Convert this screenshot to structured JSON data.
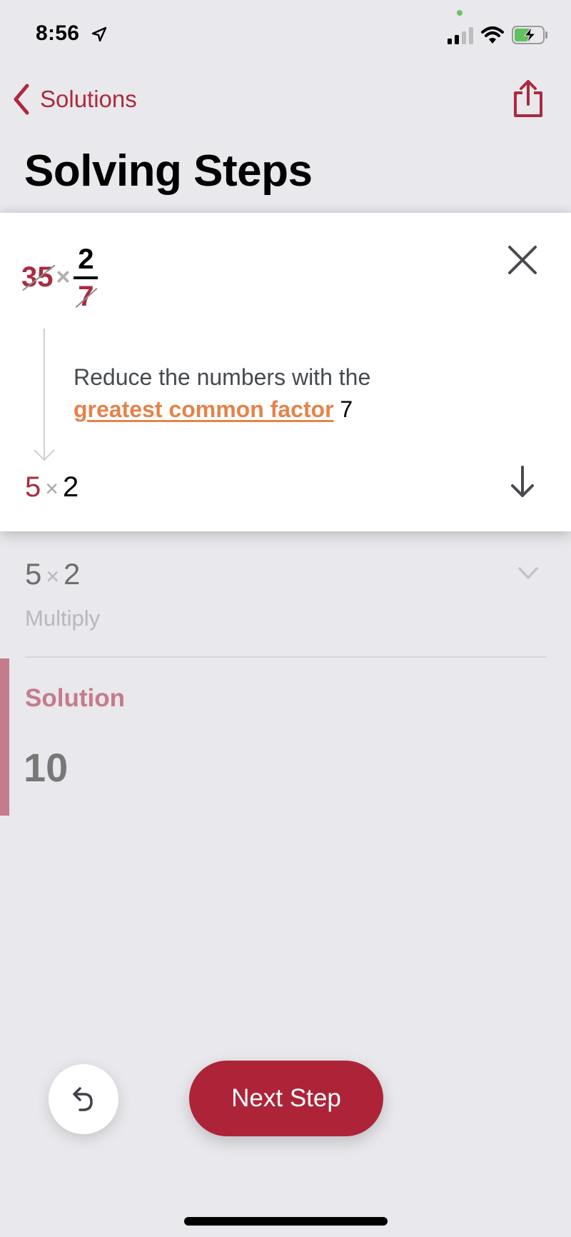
{
  "status_bar": {
    "time": "8:56",
    "location_icon": "location-arrow-icon",
    "signal_icon": "cellular-signal-icon",
    "signal_bars_active": 2,
    "signal_bars_total": 4,
    "wifi_icon": "wifi-icon",
    "battery_icon": "battery-charging-icon",
    "battery_level": 0.55,
    "mic_indicator_color": "#6cc36c"
  },
  "nav": {
    "back_label": "Solutions",
    "back_icon": "chevron-left-icon",
    "share_icon": "share-icon",
    "title": "Solving Steps"
  },
  "step_card": {
    "expression_top": {
      "left_number": "35",
      "operator": "×",
      "fraction_numerator": "2",
      "fraction_denominator": "7"
    },
    "close_icon": "close-icon",
    "explanation_prefix": "Reduce the numbers with the",
    "explanation_link": "greatest common factor",
    "explanation_value": "7",
    "expression_bottom": {
      "left": "5",
      "operator": "×",
      "right": "2"
    },
    "next_icon": "arrow-down-icon"
  },
  "next_step_preview": {
    "expression": {
      "left": "5",
      "operator": "×",
      "right": "2"
    },
    "label": "Multiply",
    "expand_icon": "chevron-down-icon"
  },
  "solution": {
    "title": "Solution",
    "value": "10"
  },
  "actions": {
    "undo_icon": "undo-icon",
    "next_step_label": "Next Step"
  },
  "colors": {
    "brand": "#ad2439",
    "link": "#e4834a",
    "solution_accent": "#c47b8b",
    "background": "#e9e8ec"
  }
}
